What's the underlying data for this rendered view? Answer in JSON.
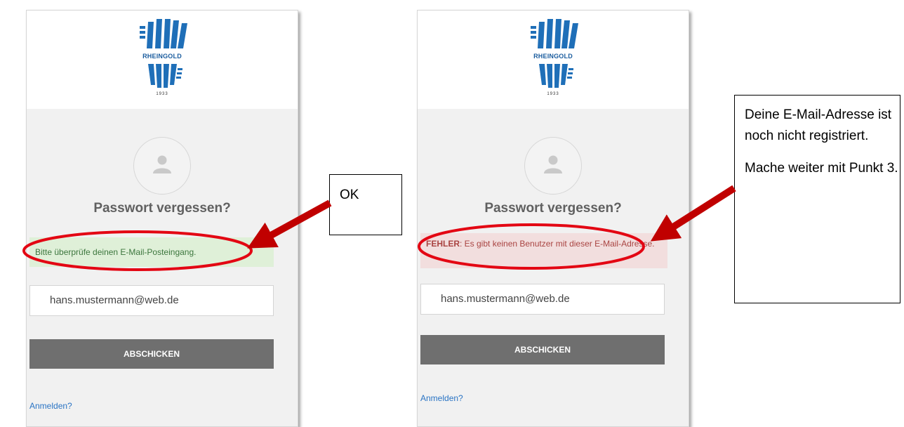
{
  "logo": {
    "text": "RHEINGOLD",
    "year": "1933"
  },
  "left_panel": {
    "title": "Passwort vergessen?",
    "message": "Bitte überprüfe deinen E-Mail-Posteingang.",
    "email_value": "hans.mustermann@web.de",
    "submit_label": "ABSCHICKEN",
    "login_link": "Anmelden?"
  },
  "right_panel": {
    "title": "Passwort vergessen?",
    "error_label": "FEHLER",
    "error_text": ": Es gibt keinen Benutzer mit dieser E-Mail-Adresse.",
    "email_value": "hans.mustermann@web.de",
    "submit_label": "ABSCHICKEN",
    "login_link": "Anmelden?"
  },
  "annotations": {
    "ok_label": "OK",
    "error_note_line1": "Deine E-Mail-Adresse ist noch nicht registriert.",
    "error_note_line2": "Mache weiter mit Punkt 3."
  },
  "colors": {
    "success_bg": "#dff0d8",
    "error_bg": "#f2dede",
    "highlight_ellipse": "#e30613",
    "arrow": "#c00000",
    "button": "#6f6f6f",
    "link": "#2a74c4",
    "logo_blue": "#1a5c9e"
  },
  "icons": {
    "avatar": "user-icon",
    "logo": "rheingold-logo"
  }
}
